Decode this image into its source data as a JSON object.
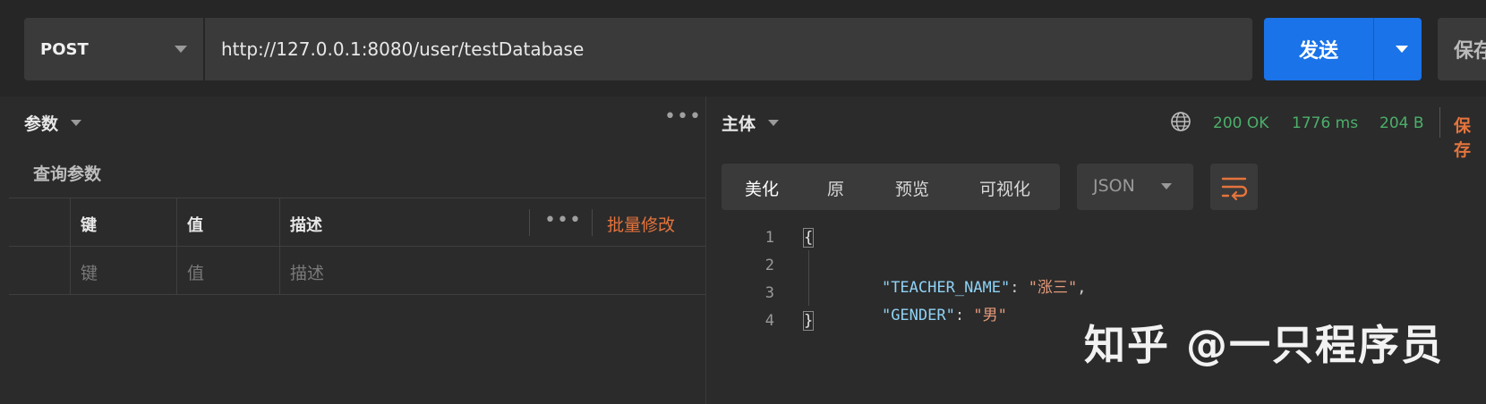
{
  "request": {
    "method": "POST",
    "url": "http://127.0.0.1:8080/user/testDatabase",
    "send_label": "发送",
    "save_label": "保存"
  },
  "params_panel": {
    "title": "参数",
    "query_title": "查询参数",
    "headers": [
      "键",
      "值",
      "描述"
    ],
    "bulk_edit": "批量修改",
    "placeholders": [
      "键",
      "值",
      "描述"
    ]
  },
  "response": {
    "title": "主体",
    "status": "200 OK",
    "time": "1776 ms",
    "size": "204 B",
    "save_label": "保存",
    "tabs": [
      "美化",
      "原",
      "预览",
      "可视化"
    ],
    "active_tab": "美化",
    "format": "JSON",
    "lines": [
      {
        "n": "1",
        "text": "{"
      },
      {
        "n": "2",
        "key": "\"TEACHER_NAME\"",
        "value": "\"涨三\"",
        "trail": ","
      },
      {
        "n": "3",
        "key": "\"GENDER\"",
        "value": "\"男\"",
        "trail": ""
      },
      {
        "n": "4",
        "text": "}"
      }
    ]
  },
  "watermark": "知乎 @一只程序员",
  "colors": {
    "accent": "#1a73e8",
    "status_ok": "#4caf6a",
    "bulk_edit": "#e5743d"
  }
}
